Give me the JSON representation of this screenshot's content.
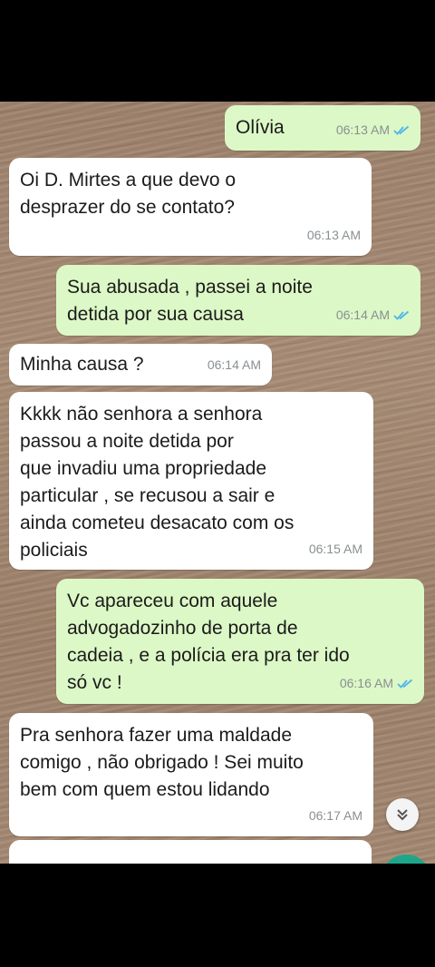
{
  "messages": [
    {
      "direction": "out",
      "text": "Olívia",
      "time": "06:13 AM",
      "read": true
    },
    {
      "direction": "in",
      "text": "Oi D. Mirtes a que devo o\ndesprazer do se contato?",
      "time": "06:13 AM"
    },
    {
      "direction": "out",
      "text": "Sua abusada , passei a noite\ndetida por sua causa",
      "time": "06:14 AM",
      "read": true
    },
    {
      "direction": "in",
      "text": "Minha causa ?",
      "time": "06:14 AM"
    },
    {
      "direction": "in",
      "text": "Kkkk não senhora a senhora\npassou a noite detida por\nque invadiu uma propriedade\nparticular , se recusou a sair e\nainda cometeu desacato com os\npoliciais",
      "time": "06:15 AM"
    },
    {
      "direction": "out",
      "text": "Vc apareceu com aquele\nadvogadozinho de porta de\ncadeia , e a polícia  era pra ter ido\nsó vc !",
      "time": "06:16 AM",
      "read": true
    },
    {
      "direction": "in",
      "text": "Pra senhora fazer uma maldade\ncomigo , não obrigado ! Sei muito\nbem com quem estou lidando",
      "time": "06:17 AM"
    }
  ],
  "colors": {
    "outgoing": "#dcf8c6",
    "incoming": "#ffffff",
    "read_ticks": "#4fb6ec",
    "fab": "#1fa68a"
  },
  "icons": {
    "read_receipt": "double-check-icon",
    "scroll_down": "chevron-double-down-icon"
  }
}
